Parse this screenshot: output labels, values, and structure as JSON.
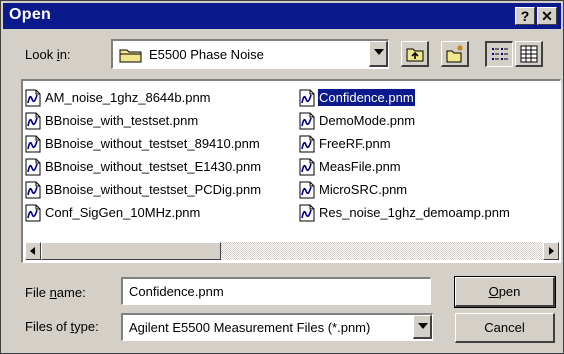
{
  "window": {
    "title": "Open",
    "help_glyph": "?",
    "close_glyph": "✕"
  },
  "look_in": {
    "label_pre": "Look ",
    "label_accel": "i",
    "label_post": "n:",
    "value": "E5500 Phase Noise",
    "icon": "folder-icon"
  },
  "toolbar": {
    "icons": [
      "up-one-level-icon",
      "create-new-folder-icon",
      "list-view-icon",
      "details-view-icon"
    ]
  },
  "files": {
    "column1": [
      {
        "name": "AM_noise_1ghz_8644b.pnm"
      },
      {
        "name": "BBnoise_with_testset.pnm"
      },
      {
        "name": "BBnoise_without_testset_89410.pnm"
      },
      {
        "name": "BBnoise_without_testset_E1430.pnm"
      },
      {
        "name": "BBnoise_without_testset_PCDig.pnm"
      },
      {
        "name": "Conf_SigGen_10MHz.pnm"
      }
    ],
    "column2": [
      {
        "name": "Confidence.pnm",
        "selected": true
      },
      {
        "name": "DemoMode.pnm"
      },
      {
        "name": "FreeRF.pnm"
      },
      {
        "name": "MeasFile.pnm"
      },
      {
        "name": "MicroSRC.pnm"
      },
      {
        "name": "Res_noise_1ghz_demoamp.pnm"
      }
    ]
  },
  "file_name": {
    "label_pre": "File ",
    "label_accel": "n",
    "label_post": "ame:",
    "value": "Confidence.pnm"
  },
  "file_type": {
    "label_pre": "Files of ",
    "label_accel": "t",
    "label_post": "ype:",
    "value": "Agilent E5500 Measurement Files (*.pnm)"
  },
  "buttons": {
    "open_accel": "O",
    "open_rest": "pen",
    "cancel": "Cancel"
  },
  "colors": {
    "titlebar": "#0a1a8c",
    "face": "#d4d0c8",
    "selection": "#0a1a8c"
  }
}
